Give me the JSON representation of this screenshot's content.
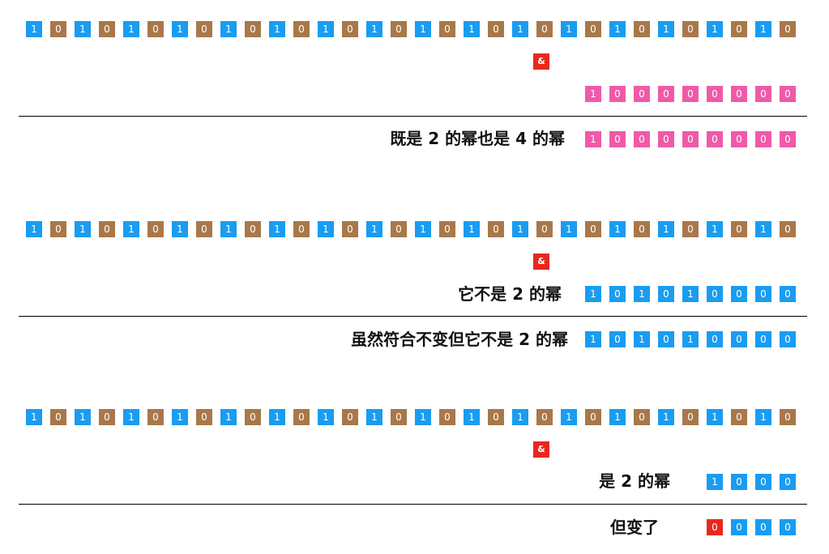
{
  "colors": {
    "blue": "#1a9cf0",
    "brown": "#a8784a",
    "pink": "#ef5aa8",
    "red": "#e8281e"
  },
  "bits32": [
    "1",
    "0",
    "1",
    "0",
    "1",
    "0",
    "1",
    "0",
    "1",
    "0",
    "1",
    "0",
    "1",
    "0",
    "1",
    "0",
    "1",
    "0",
    "1",
    "0",
    "1",
    "0",
    "1",
    "0",
    "1",
    "0",
    "1",
    "0",
    "1",
    "0",
    "1",
    "0"
  ],
  "operator": "&",
  "section1": {
    "mask": [
      "1",
      "0",
      "0",
      "0",
      "0",
      "0",
      "0",
      "0",
      "0"
    ],
    "label": "既是 2 的幂也是 4 的幂",
    "result": [
      "1",
      "0",
      "0",
      "0",
      "0",
      "0",
      "0",
      "0",
      "0"
    ]
  },
  "section2": {
    "mask_label": "它不是 2 的幂",
    "mask": [
      "1",
      "0",
      "1",
      "0",
      "1",
      "0",
      "0",
      "0",
      "0"
    ],
    "label": "虽然符合不变但它不是 2 的幂",
    "result": [
      "1",
      "0",
      "1",
      "0",
      "1",
      "0",
      "0",
      "0",
      "0"
    ]
  },
  "section3": {
    "mask_label": "是 2 的幂",
    "mask": [
      "1",
      "0",
      "0",
      "0"
    ],
    "label": "但变了",
    "result": [
      "0",
      "0",
      "0",
      "0"
    ]
  }
}
